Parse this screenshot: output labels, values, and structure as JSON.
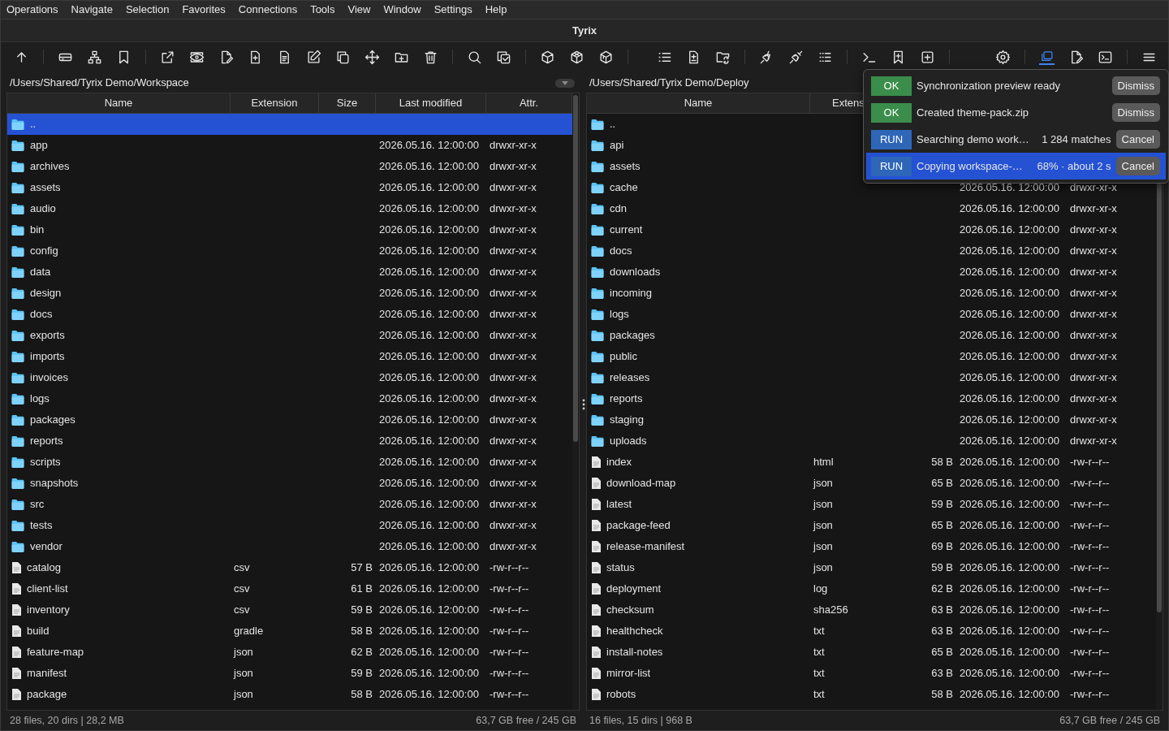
{
  "menu": [
    "Operations",
    "Navigate",
    "Selection",
    "Favorites",
    "Connections",
    "Tools",
    "View",
    "Window",
    "Settings",
    "Help"
  ],
  "window": {
    "title": "Tyrix"
  },
  "toolbar": [
    [
      {
        "kind": "up",
        "selected": false
      }
    ],
    [
      {
        "kind": "drive",
        "selected": false
      },
      {
        "kind": "network",
        "selected": false
      },
      {
        "kind": "bookmark",
        "selected": false
      }
    ],
    [
      {
        "kind": "external",
        "selected": false
      },
      {
        "kind": "eye",
        "selected": false
      },
      {
        "kind": "fileedit",
        "selected": false
      },
      {
        "kind": "fileplus",
        "selected": false
      },
      {
        "kind": "document",
        "selected": false
      },
      {
        "kind": "pencil",
        "selected": false
      },
      {
        "kind": "copy",
        "selected": false
      },
      {
        "kind": "move",
        "selected": false
      },
      {
        "kind": "folderplus",
        "selected": false
      },
      {
        "kind": "trash",
        "selected": false
      }
    ],
    [
      {
        "kind": "search",
        "selected": false
      },
      {
        "kind": "checkcopy",
        "selected": false
      }
    ],
    [
      {
        "kind": "cube",
        "selected": false
      },
      {
        "kind": "cubes",
        "selected": false
      },
      {
        "kind": "cubeopen",
        "selected": false
      }
    ],
    [
      {
        "kind": "list",
        "selected": false
      },
      {
        "kind": "filediff",
        "selected": false
      },
      {
        "kind": "foldersync",
        "selected": false
      }
    ],
    [
      {
        "kind": "plug",
        "selected": false
      },
      {
        "kind": "unplug",
        "selected": false
      },
      {
        "kind": "dotlist",
        "selected": false
      }
    ],
    [
      {
        "kind": "terminal",
        "selected": false
      },
      {
        "kind": "bookmarkplus",
        "selected": false
      },
      {
        "kind": "plussquare",
        "selected": false
      }
    ],
    [
      {
        "kind": "gear",
        "selected": false
      }
    ],
    [
      {
        "kind": "stack",
        "selected": true
      },
      {
        "kind": "fileedit",
        "selected": false
      },
      {
        "kind": "termbox",
        "selected": false
      }
    ],
    [
      {
        "kind": "menu",
        "selected": false
      }
    ]
  ],
  "panels": [
    {
      "path": "/Users/Shared/Tyrix Demo/Workspace",
      "columns": [
        "Name",
        "Extension",
        "Size",
        "Last modified",
        "Attr."
      ],
      "rows": [
        {
          "kind": "folder",
          "name": "..",
          "selected": true
        },
        {
          "kind": "folder",
          "name": "app",
          "modified": "2026.05.16. 12:00:00",
          "attr": "drwxr-xr-x",
          "selected": false
        },
        {
          "kind": "folder",
          "name": "archives",
          "modified": "2026.05.16. 12:00:00",
          "attr": "drwxr-xr-x",
          "selected": false
        },
        {
          "kind": "folder",
          "name": "assets",
          "modified": "2026.05.16. 12:00:00",
          "attr": "drwxr-xr-x",
          "selected": false
        },
        {
          "kind": "folder",
          "name": "audio",
          "modified": "2026.05.16. 12:00:00",
          "attr": "drwxr-xr-x",
          "selected": false
        },
        {
          "kind": "folder",
          "name": "bin",
          "modified": "2026.05.16. 12:00:00",
          "attr": "drwxr-xr-x",
          "selected": false
        },
        {
          "kind": "folder",
          "name": "config",
          "modified": "2026.05.16. 12:00:00",
          "attr": "drwxr-xr-x",
          "selected": false
        },
        {
          "kind": "folder",
          "name": "data",
          "modified": "2026.05.16. 12:00:00",
          "attr": "drwxr-xr-x",
          "selected": false
        },
        {
          "kind": "folder",
          "name": "design",
          "modified": "2026.05.16. 12:00:00",
          "attr": "drwxr-xr-x",
          "selected": false
        },
        {
          "kind": "folder",
          "name": "docs",
          "modified": "2026.05.16. 12:00:00",
          "attr": "drwxr-xr-x",
          "selected": false
        },
        {
          "kind": "folder",
          "name": "exports",
          "modified": "2026.05.16. 12:00:00",
          "attr": "drwxr-xr-x",
          "selected": false
        },
        {
          "kind": "folder",
          "name": "imports",
          "modified": "2026.05.16. 12:00:00",
          "attr": "drwxr-xr-x",
          "selected": false
        },
        {
          "kind": "folder",
          "name": "invoices",
          "modified": "2026.05.16. 12:00:00",
          "attr": "drwxr-xr-x",
          "selected": false
        },
        {
          "kind": "folder",
          "name": "logs",
          "modified": "2026.05.16. 12:00:00",
          "attr": "drwxr-xr-x",
          "selected": false
        },
        {
          "kind": "folder",
          "name": "packages",
          "modified": "2026.05.16. 12:00:00",
          "attr": "drwxr-xr-x",
          "selected": false
        },
        {
          "kind": "folder",
          "name": "reports",
          "modified": "2026.05.16. 12:00:00",
          "attr": "drwxr-xr-x",
          "selected": false
        },
        {
          "kind": "folder",
          "name": "scripts",
          "modified": "2026.05.16. 12:00:00",
          "attr": "drwxr-xr-x",
          "selected": false
        },
        {
          "kind": "folder",
          "name": "snapshots",
          "modified": "2026.05.16. 12:00:00",
          "attr": "drwxr-xr-x",
          "selected": false
        },
        {
          "kind": "folder",
          "name": "src",
          "modified": "2026.05.16. 12:00:00",
          "attr": "drwxr-xr-x",
          "selected": false
        },
        {
          "kind": "folder",
          "name": "tests",
          "modified": "2026.05.16. 12:00:00",
          "attr": "drwxr-xr-x",
          "selected": false
        },
        {
          "kind": "folder",
          "name": "vendor",
          "modified": "2026.05.16. 12:00:00",
          "attr": "drwxr-xr-x",
          "selected": false
        },
        {
          "kind": "file",
          "name": "catalog",
          "ext": "csv",
          "size": "57 B",
          "modified": "2026.05.16. 12:00:00",
          "attr": "-rw-r--r--",
          "selected": false
        },
        {
          "kind": "file",
          "name": "client-list",
          "ext": "csv",
          "size": "61 B",
          "modified": "2026.05.16. 12:00:00",
          "attr": "-rw-r--r--",
          "selected": false
        },
        {
          "kind": "file",
          "name": "inventory",
          "ext": "csv",
          "size": "59 B",
          "modified": "2026.05.16. 12:00:00",
          "attr": "-rw-r--r--",
          "selected": false
        },
        {
          "kind": "file",
          "name": "build",
          "ext": "gradle",
          "size": "58 B",
          "modified": "2026.05.16. 12:00:00",
          "attr": "-rw-r--r--",
          "selected": false
        },
        {
          "kind": "file",
          "name": "feature-map",
          "ext": "json",
          "size": "62 B",
          "modified": "2026.05.16. 12:00:00",
          "attr": "-rw-r--r--",
          "selected": false
        },
        {
          "kind": "file",
          "name": "manifest",
          "ext": "json",
          "size": "59 B",
          "modified": "2026.05.16. 12:00:00",
          "attr": "-rw-r--r--",
          "selected": false
        },
        {
          "kind": "file",
          "name": "package",
          "ext": "json",
          "size": "58 B",
          "modified": "2026.05.16. 12:00:00",
          "attr": "-rw-r--r--",
          "selected": false
        }
      ],
      "status_left": "28 files, 20 dirs | 28,2 MB",
      "status_right": "63,7 GB free / 245 GB"
    },
    {
      "path": "/Users/Shared/Tyrix Demo/Deploy",
      "columns": [
        "Name",
        "Extens"
      ],
      "rows": [
        {
          "kind": "folder",
          "name": "..",
          "selected": false
        },
        {
          "kind": "folder",
          "name": "api",
          "selected": false
        },
        {
          "kind": "folder",
          "name": "assets",
          "selected": false
        },
        {
          "kind": "folder",
          "name": "cache",
          "modified": "2026.05.16. 12:00:00",
          "attr": "drwxr-xr-x",
          "selected": false
        },
        {
          "kind": "folder",
          "name": "cdn",
          "modified": "2026.05.16. 12:00:00",
          "attr": "drwxr-xr-x",
          "selected": false
        },
        {
          "kind": "folder",
          "name": "current",
          "modified": "2026.05.16. 12:00:00",
          "attr": "drwxr-xr-x",
          "selected": false
        },
        {
          "kind": "folder",
          "name": "docs",
          "modified": "2026.05.16. 12:00:00",
          "attr": "drwxr-xr-x",
          "selected": false
        },
        {
          "kind": "folder",
          "name": "downloads",
          "modified": "2026.05.16. 12:00:00",
          "attr": "drwxr-xr-x",
          "selected": false
        },
        {
          "kind": "folder",
          "name": "incoming",
          "modified": "2026.05.16. 12:00:00",
          "attr": "drwxr-xr-x",
          "selected": false
        },
        {
          "kind": "folder",
          "name": "logs",
          "modified": "2026.05.16. 12:00:00",
          "attr": "drwxr-xr-x",
          "selected": false
        },
        {
          "kind": "folder",
          "name": "packages",
          "modified": "2026.05.16. 12:00:00",
          "attr": "drwxr-xr-x",
          "selected": false
        },
        {
          "kind": "folder",
          "name": "public",
          "modified": "2026.05.16. 12:00:00",
          "attr": "drwxr-xr-x",
          "selected": false
        },
        {
          "kind": "folder",
          "name": "releases",
          "modified": "2026.05.16. 12:00:00",
          "attr": "drwxr-xr-x",
          "selected": false
        },
        {
          "kind": "folder",
          "name": "reports",
          "modified": "2026.05.16. 12:00:00",
          "attr": "drwxr-xr-x",
          "selected": false
        },
        {
          "kind": "folder",
          "name": "staging",
          "modified": "2026.05.16. 12:00:00",
          "attr": "drwxr-xr-x",
          "selected": false
        },
        {
          "kind": "folder",
          "name": "uploads",
          "modified": "2026.05.16. 12:00:00",
          "attr": "drwxr-xr-x",
          "selected": false
        },
        {
          "kind": "file",
          "name": "index",
          "ext": "html",
          "size": "58 B",
          "modified": "2026.05.16. 12:00:00",
          "attr": "-rw-r--r--",
          "selected": false
        },
        {
          "kind": "file",
          "name": "download-map",
          "ext": "json",
          "size": "65 B",
          "modified": "2026.05.16. 12:00:00",
          "attr": "-rw-r--r--",
          "selected": false
        },
        {
          "kind": "file",
          "name": "latest",
          "ext": "json",
          "size": "59 B",
          "modified": "2026.05.16. 12:00:00",
          "attr": "-rw-r--r--",
          "selected": false
        },
        {
          "kind": "file",
          "name": "package-feed",
          "ext": "json",
          "size": "65 B",
          "modified": "2026.05.16. 12:00:00",
          "attr": "-rw-r--r--",
          "selected": false
        },
        {
          "kind": "file",
          "name": "release-manifest",
          "ext": "json",
          "size": "69 B",
          "modified": "2026.05.16. 12:00:00",
          "attr": "-rw-r--r--",
          "selected": false
        },
        {
          "kind": "file",
          "name": "status",
          "ext": "json",
          "size": "59 B",
          "modified": "2026.05.16. 12:00:00",
          "attr": "-rw-r--r--",
          "selected": false
        },
        {
          "kind": "file",
          "name": "deployment",
          "ext": "log",
          "size": "62 B",
          "modified": "2026.05.16. 12:00:00",
          "attr": "-rw-r--r--",
          "selected": false
        },
        {
          "kind": "file",
          "name": "checksum",
          "ext": "sha256",
          "size": "63 B",
          "modified": "2026.05.16. 12:00:00",
          "attr": "-rw-r--r--",
          "selected": false
        },
        {
          "kind": "file",
          "name": "healthcheck",
          "ext": "txt",
          "size": "63 B",
          "modified": "2026.05.16. 12:00:00",
          "attr": "-rw-r--r--",
          "selected": false
        },
        {
          "kind": "file",
          "name": "install-notes",
          "ext": "txt",
          "size": "65 B",
          "modified": "2026.05.16. 12:00:00",
          "attr": "-rw-r--r--",
          "selected": false
        },
        {
          "kind": "file",
          "name": "mirror-list",
          "ext": "txt",
          "size": "63 B",
          "modified": "2026.05.16. 12:00:00",
          "attr": "-rw-r--r--",
          "selected": false
        },
        {
          "kind": "file",
          "name": "robots",
          "ext": "txt",
          "size": "58 B",
          "modified": "2026.05.16. 12:00:00",
          "attr": "-rw-r--r--",
          "selected": false
        }
      ],
      "status_left": "16 files, 15 dirs | 968 B",
      "status_right": "63,7 GB free / 245 GB"
    }
  ],
  "notifications": [
    {
      "kind": "ok",
      "badge": "OK",
      "message": "Synchronization preview ready",
      "action": "Dismiss",
      "selected": false
    },
    {
      "kind": "ok",
      "badge": "OK",
      "message": "Created theme-pack.zip",
      "action": "Dismiss",
      "selected": false
    },
    {
      "kind": "run",
      "badge": "RUN",
      "message": "Searching demo work…",
      "detail": "1 284 matches",
      "action": "Cancel",
      "selected": false
    },
    {
      "kind": "run",
      "badge": "RUN",
      "message": "Copying workspace-…",
      "detail": "68% · about 2 s",
      "action": "Cancel",
      "selected": true
    }
  ]
}
